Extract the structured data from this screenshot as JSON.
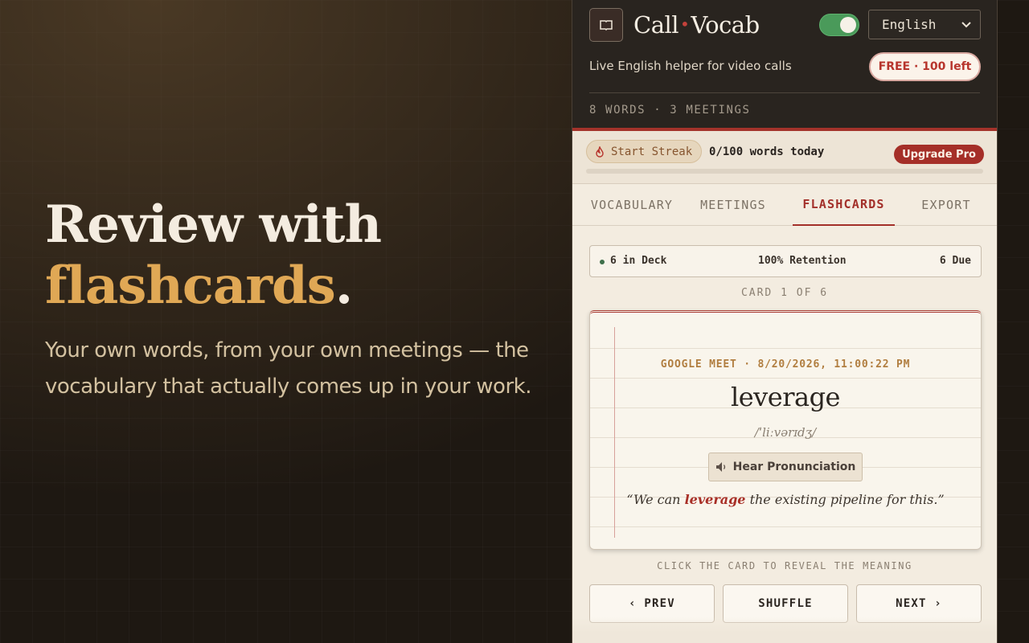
{
  "hero": {
    "title_line1": "Review with",
    "title_accent": "flashcards",
    "title_dot": ".",
    "subtitle": "Your own words, from your own meetings — the vocabulary that actually comes up in your work."
  },
  "panel": {
    "brand_left": "Call",
    "brand_sep": "•",
    "brand_right": "Vocab",
    "logo_icon": "book-icon",
    "toggle_on": true,
    "language": "English",
    "tagline": "Live English helper for video calls",
    "free_badge": "FREE · 100 left",
    "stats": "8 WORDS · 3 MEETINGS"
  },
  "streak": {
    "label": "Start Streak",
    "icon": "flame-icon",
    "words_today": "0/100 words today",
    "progress": 0,
    "upgrade": "Upgrade Pro"
  },
  "tabs": [
    {
      "label": "VOCABULARY",
      "active": false
    },
    {
      "label": "MEETINGS",
      "active": false
    },
    {
      "label": "FLASHCARDS",
      "active": true
    },
    {
      "label": "EXPORT",
      "active": false
    }
  ],
  "deck": {
    "in_deck": "6 in Deck",
    "retention": "100% Retention",
    "due": "6 Due"
  },
  "card_counter": "CARD 1 OF 6",
  "card": {
    "meta": "GOOGLE MEET · 8/20/2026, 11:00:22 PM",
    "word": "leverage",
    "ipa": "/ˈliːvərɪdʒ/",
    "hear_label": "Hear Pronunciation",
    "example_before": "“We can ",
    "example_highlight": "leverage",
    "example_after": " the existing pipeline for this.”"
  },
  "hint": "CLICK THE CARD TO REVEAL THE MEANING",
  "nav": {
    "prev": "‹ PREV",
    "shuffle": "SHUFFLE",
    "next": "NEXT ›"
  },
  "colors": {
    "accent_red": "#a52f28",
    "accent_gold": "#e0a855",
    "toggle_green": "#4a9a5a"
  }
}
